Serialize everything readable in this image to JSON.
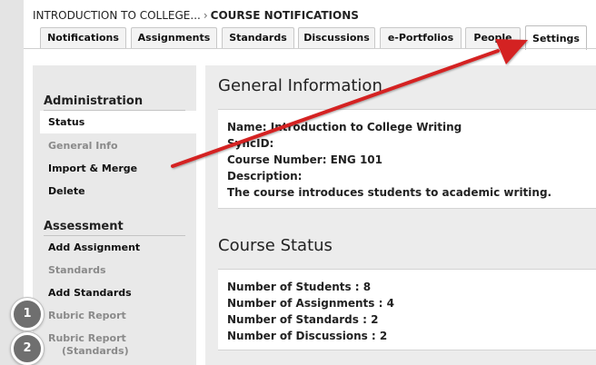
{
  "breadcrumb": {
    "course": "INTRODUCTION TO COLLEGE...",
    "separator": "›",
    "page": "COURSE NOTIFICATIONS"
  },
  "tabs": [
    {
      "label": "Notifications"
    },
    {
      "label": "Assignments"
    },
    {
      "label": "Standards"
    },
    {
      "label": "Discussions"
    },
    {
      "label": "e-Portfolios"
    },
    {
      "label": "People"
    },
    {
      "label": "Settings",
      "active": true
    }
  ],
  "sidebar": {
    "administration": {
      "heading": "Administration",
      "items": [
        {
          "label": "Status",
          "selected": true
        },
        {
          "label": "General Info",
          "muted": true
        },
        {
          "label": "Import & Merge"
        },
        {
          "label": "Delete"
        }
      ]
    },
    "assessment": {
      "heading": "Assessment",
      "items": [
        {
          "label": "Add Assignment"
        },
        {
          "label": "Standards",
          "muted": true
        },
        {
          "label": "Add Standards"
        },
        {
          "label": "Rubric Report",
          "muted": true
        },
        {
          "label": "Rubric Report",
          "label2": "(Standards)",
          "muted": true
        }
      ]
    }
  },
  "badges": [
    {
      "number": "1"
    },
    {
      "number": "2"
    }
  ],
  "general_info": {
    "title": "General Information",
    "lines": [
      "Name: Introduction to College Writing",
      "SyncID:",
      "Course Number: ENG 101",
      "Description:",
      "The course introduces students to academic writing."
    ]
  },
  "course_status": {
    "title": "Course Status",
    "lines": [
      "Number of Students : 8",
      "Number of Assignments : 4",
      "Number of Standards : 2",
      "Number of Discussions : 2"
    ]
  },
  "colors": {
    "arrow": "#d42020",
    "badge": "#6f6f6f",
    "sidebar_bg": "#e9e9e9",
    "main_bg": "#ececec"
  }
}
